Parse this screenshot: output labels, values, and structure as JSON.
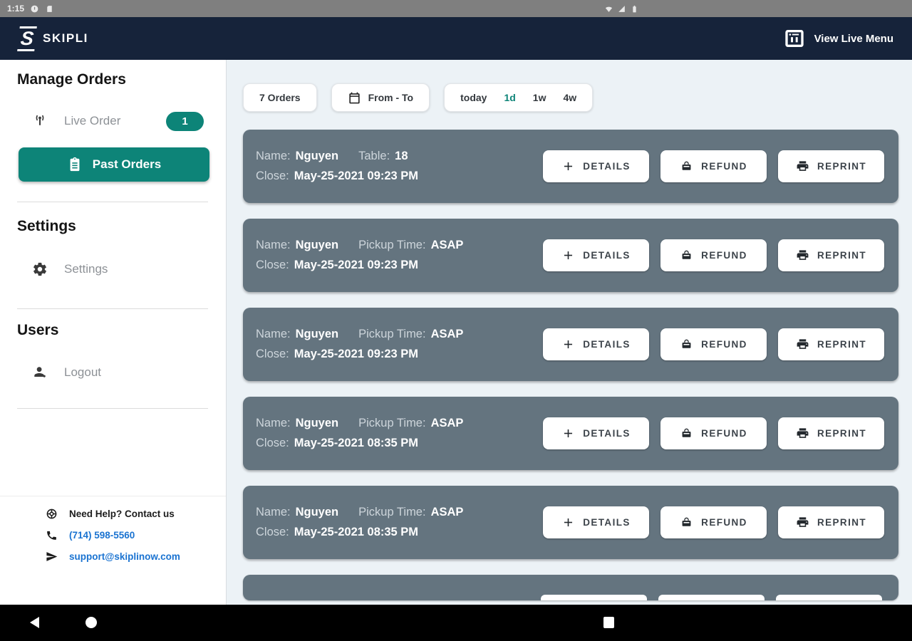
{
  "status_bar": {
    "time": "1:15"
  },
  "app_bar": {
    "logo_glyph": "S",
    "brand": "SKIPLI",
    "menu_button_label": "View Live Menu"
  },
  "sidebar": {
    "manage_heading": "Manage Orders",
    "live_order_label": "Live Order",
    "live_order_badge": "1",
    "past_orders_label": "Past Orders",
    "settings_heading": "Settings",
    "settings_label": "Settings",
    "users_heading": "Users",
    "logout_label": "Logout",
    "footer": {
      "help": "Need Help? Contact us",
      "phone": "(714) 598-5560",
      "email": "support@skiplinow.com"
    }
  },
  "filters": {
    "order_count": "7 Orders",
    "date_range": "From - To",
    "quick": {
      "today": "today",
      "d1": "1d",
      "w1": "1w",
      "w4": "4w"
    },
    "quick_active": "1d"
  },
  "actions": {
    "details": "DETAILS",
    "refund": "REFUND",
    "reprint": "REPRINT"
  },
  "orders": [
    {
      "name_label": "Name:",
      "name": "Nguyen",
      "meta_label": "Table:",
      "meta_value": "18",
      "close_label": "Close:",
      "close_value": "May-25-2021 09:23 PM"
    },
    {
      "name_label": "Name:",
      "name": "Nguyen",
      "meta_label": "Pickup Time:",
      "meta_value": "ASAP",
      "close_label": "Close:",
      "close_value": "May-25-2021 09:23 PM"
    },
    {
      "name_label": "Name:",
      "name": "Nguyen",
      "meta_label": "Pickup Time:",
      "meta_value": "ASAP",
      "close_label": "Close:",
      "close_value": "May-25-2021 09:23 PM"
    },
    {
      "name_label": "Name:",
      "name": "Nguyen",
      "meta_label": "Pickup Time:",
      "meta_value": "ASAP",
      "close_label": "Close:",
      "close_value": "May-25-2021 08:35 PM"
    },
    {
      "name_label": "Name:",
      "name": "Nguyen",
      "meta_label": "Pickup Time:",
      "meta_value": "ASAP",
      "close_label": "Close:",
      "close_value": "May-25-2021 08:35 PM"
    }
  ],
  "icons": [
    "live-signal-icon",
    "clipboard-icon",
    "gear-icon",
    "person-logout-icon",
    "lifebuoy-help-icon",
    "phone-icon",
    "send-icon",
    "calendar-icon",
    "plus-icon",
    "cash-register-icon",
    "printer-icon",
    "menu-board-icon",
    "wifi-icon",
    "cell-signal-icon",
    "battery-icon",
    "back-icon",
    "home-icon",
    "recents-icon"
  ],
  "colors": {
    "accent_teal": "#0d8478",
    "card_slate": "#64747f",
    "header_navy": "#16233a",
    "link_blue": "#1a73d1",
    "main_bg": "#ecf2f6"
  }
}
